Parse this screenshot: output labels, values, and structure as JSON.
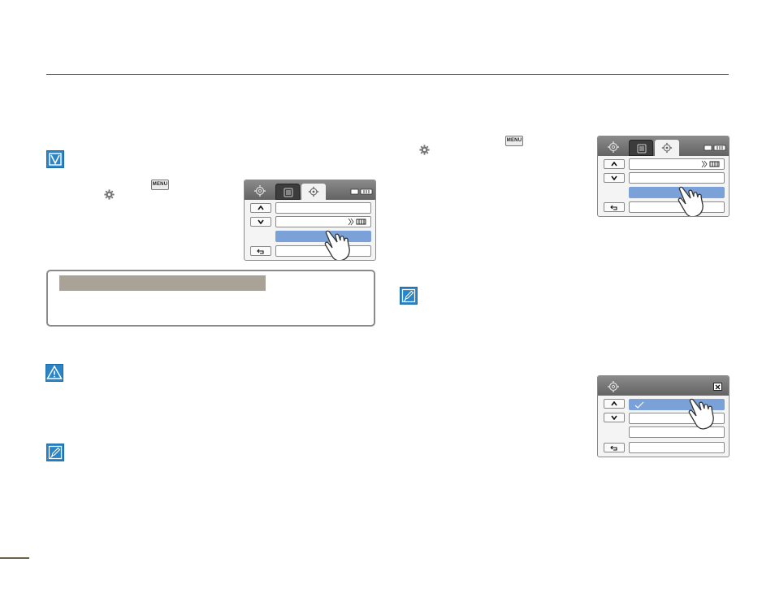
{
  "page": {
    "accent_color": "#2a84c8",
    "selection_color": "#7aa1d8"
  },
  "icons": {
    "check_box": "check-box-icon",
    "warning": "warning-triangle-icon",
    "note": "note-pencil-icon",
    "settings": "gear-icon",
    "menu_key": "menu-key-icon"
  },
  "menu_key": {
    "label": "MENU"
  }
}
